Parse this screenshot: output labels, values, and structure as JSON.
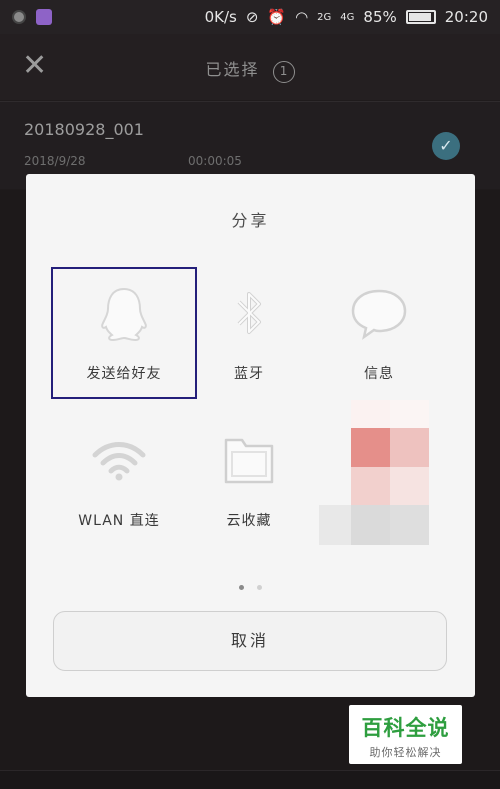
{
  "status_bar": {
    "speed": "0K/s",
    "network_2g": "2G",
    "network_4g": "4G",
    "battery": "85%",
    "time": "20:20"
  },
  "header": {
    "title": "已选择",
    "count": "1",
    "close_icon": "close-icon"
  },
  "file": {
    "name": "20180928_001",
    "date": "2018/9/28",
    "duration": "00:00:05"
  },
  "share_dialog": {
    "title": "分享",
    "items": [
      {
        "label": "发送给好友",
        "icon": "qq-penguin-icon"
      },
      {
        "label": "蓝牙",
        "icon": "bluetooth-icon"
      },
      {
        "label": "信息",
        "icon": "message-bubble-icon"
      },
      {
        "label": "WLAN 直连",
        "icon": "wifi-icon"
      },
      {
        "label": "云收藏",
        "icon": "cloud-folder-icon"
      }
    ],
    "cancel_label": "取消"
  },
  "watermark": {
    "main": "百科全说",
    "sub": "助你轻松解决"
  },
  "colors": {
    "highlight_border": "#241f7a",
    "check_bg": "#3b6f7f",
    "watermark_green": "#2e9e3f"
  }
}
